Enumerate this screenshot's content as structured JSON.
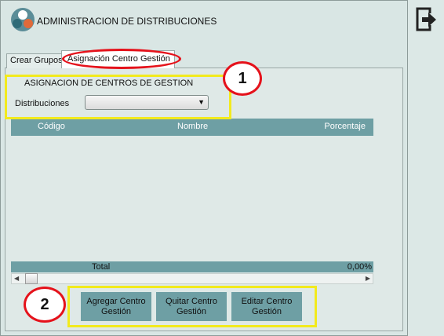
{
  "header": {
    "title": "ADMINISTRACION DE DISTRIBUCIONES",
    "logo_icon": "app-logo-icon"
  },
  "tabs": [
    {
      "label": "Crear Grupos"
    },
    {
      "label": "Asignación Centro Gestión",
      "active": true
    }
  ],
  "section": {
    "title": "ASIGNACION DE CENTROS DE GESTION",
    "distribuciones_label": "Distribuciones",
    "distribuciones_value": ""
  },
  "grid": {
    "columns": [
      "Código",
      "Nombre",
      "Porcentaje"
    ],
    "rows": [],
    "footer_label": "Total",
    "footer_value": "0,00%"
  },
  "buttons": {
    "agregar": "Agregar Centro Gestión",
    "quitar": "Quitar Centro Gestión",
    "editar": "Editar Centro Gestión"
  },
  "annotations": {
    "badge_1": "1",
    "badge_2": "2"
  },
  "icons": {
    "exit": "exit-icon"
  },
  "colors": {
    "grid_header": "#6e9fa4",
    "highlight": "#f2ea1d",
    "annotation_red": "#e5121b",
    "background": "#d9e6e4"
  }
}
